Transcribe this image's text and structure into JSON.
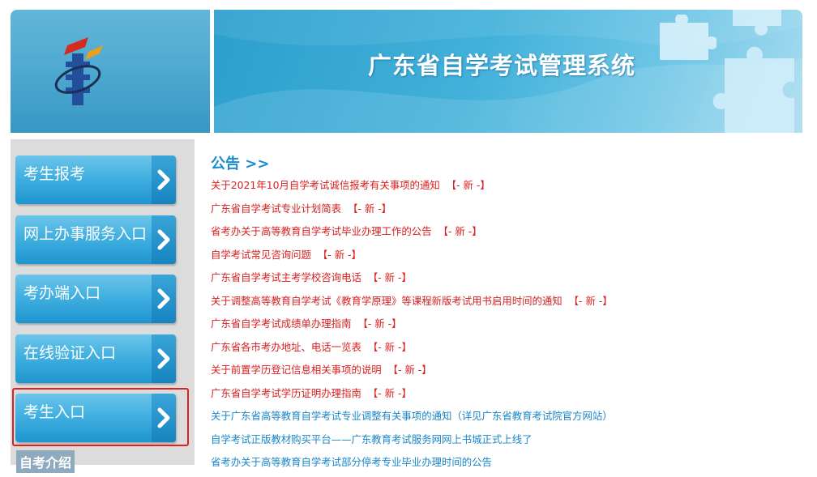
{
  "header": {
    "title": "广东省自学考试管理系统"
  },
  "sidebar": {
    "buttons": [
      {
        "label": "考生报考"
      },
      {
        "label": "网上办事服务入口"
      },
      {
        "label": "考办端入口"
      },
      {
        "label": "在线验证入口"
      },
      {
        "label": "考生入口"
      }
    ],
    "section_title": "自考介绍"
  },
  "notices": {
    "heading": "公告 >>",
    "new_tag": "【- 新 -】",
    "items": [
      {
        "text": "关于2021年10月自学考试诚信报考有关事项的通知",
        "new": true,
        "color": "#d82020"
      },
      {
        "text": "广东省自学考试专业计划简表",
        "new": true,
        "color": "#d82020"
      },
      {
        "text": "省考办关于高等教育自学考试毕业办理工作的公告",
        "new": true,
        "color": "#d82020"
      },
      {
        "text": "自学考试常见咨询问题",
        "new": true,
        "color": "#d82020"
      },
      {
        "text": "广东省自学考试主考学校咨询电话",
        "new": true,
        "color": "#d82020"
      },
      {
        "text": "关于调整高等教育自学考试《教育学原理》等课程新版考试用书启用时间的通知",
        "new": true,
        "color": "#d82020"
      },
      {
        "text": "广东省自学考试成绩单办理指南",
        "new": true,
        "color": "#d82020"
      },
      {
        "text": "广东省各市考办地址、电话一览表",
        "new": true,
        "color": "#d82020"
      },
      {
        "text": "关于前置学历登记信息相关事项的说明",
        "new": true,
        "color": "#d82020"
      },
      {
        "text": "广东省自学考试学历证明办理指南",
        "new": true,
        "color": "#d82020"
      },
      {
        "text": "关于广东省高等教育自学考试专业调整有关事项的通知（详见广东省教育考试院官方网站）",
        "new": false,
        "color": "#1a86c8"
      },
      {
        "text": "自学考试正版教材购买平台——广东教育考试服务网网上书城正式上线了",
        "new": false,
        "color": "#1a86c8"
      },
      {
        "text": "省考办关于高等教育自学考试部分停考专业毕业办理时间的公告",
        "new": false,
        "color": "#1a86c8"
      }
    ]
  },
  "colors": {
    "accent": "#1a8ccf",
    "notice_red": "#d82020",
    "notice_blue": "#1a86c8",
    "highlight_box": "#e02020"
  }
}
